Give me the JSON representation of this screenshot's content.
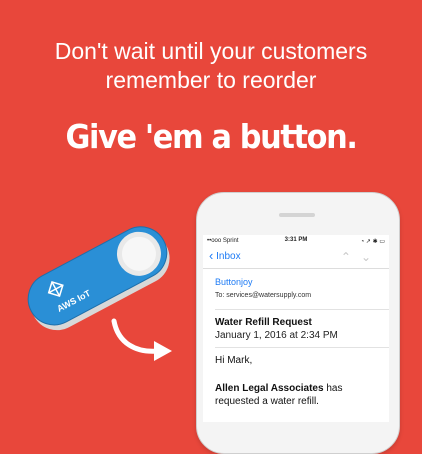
{
  "headline": {
    "line1": "Don't wait until your customers",
    "line2": "remember to reorder"
  },
  "tagline": "Give 'em a button.",
  "dash_button": {
    "label": "AWS IoT",
    "icon": "aws-iot-icon"
  },
  "phone": {
    "status": {
      "carrier": "••ooo Sprint",
      "time": "3:31 PM",
      "right": "◔ ↗ ✱ ▭"
    },
    "nav": {
      "back_label": "Inbox"
    },
    "email": {
      "from": "Buttonjoy",
      "to": "To: services@watersupply.com",
      "subject": "Water Refill Request",
      "date": "January 1, 2016 at 2:34 PM",
      "greeting": "Hi Mark,",
      "sender_bold": "Allen Legal Associates",
      "body_rest": " has requested a water refill."
    }
  },
  "colors": {
    "background": "#e8473b",
    "ios_blue": "#1e7bf5",
    "button_blue": "#2a8fd6"
  }
}
